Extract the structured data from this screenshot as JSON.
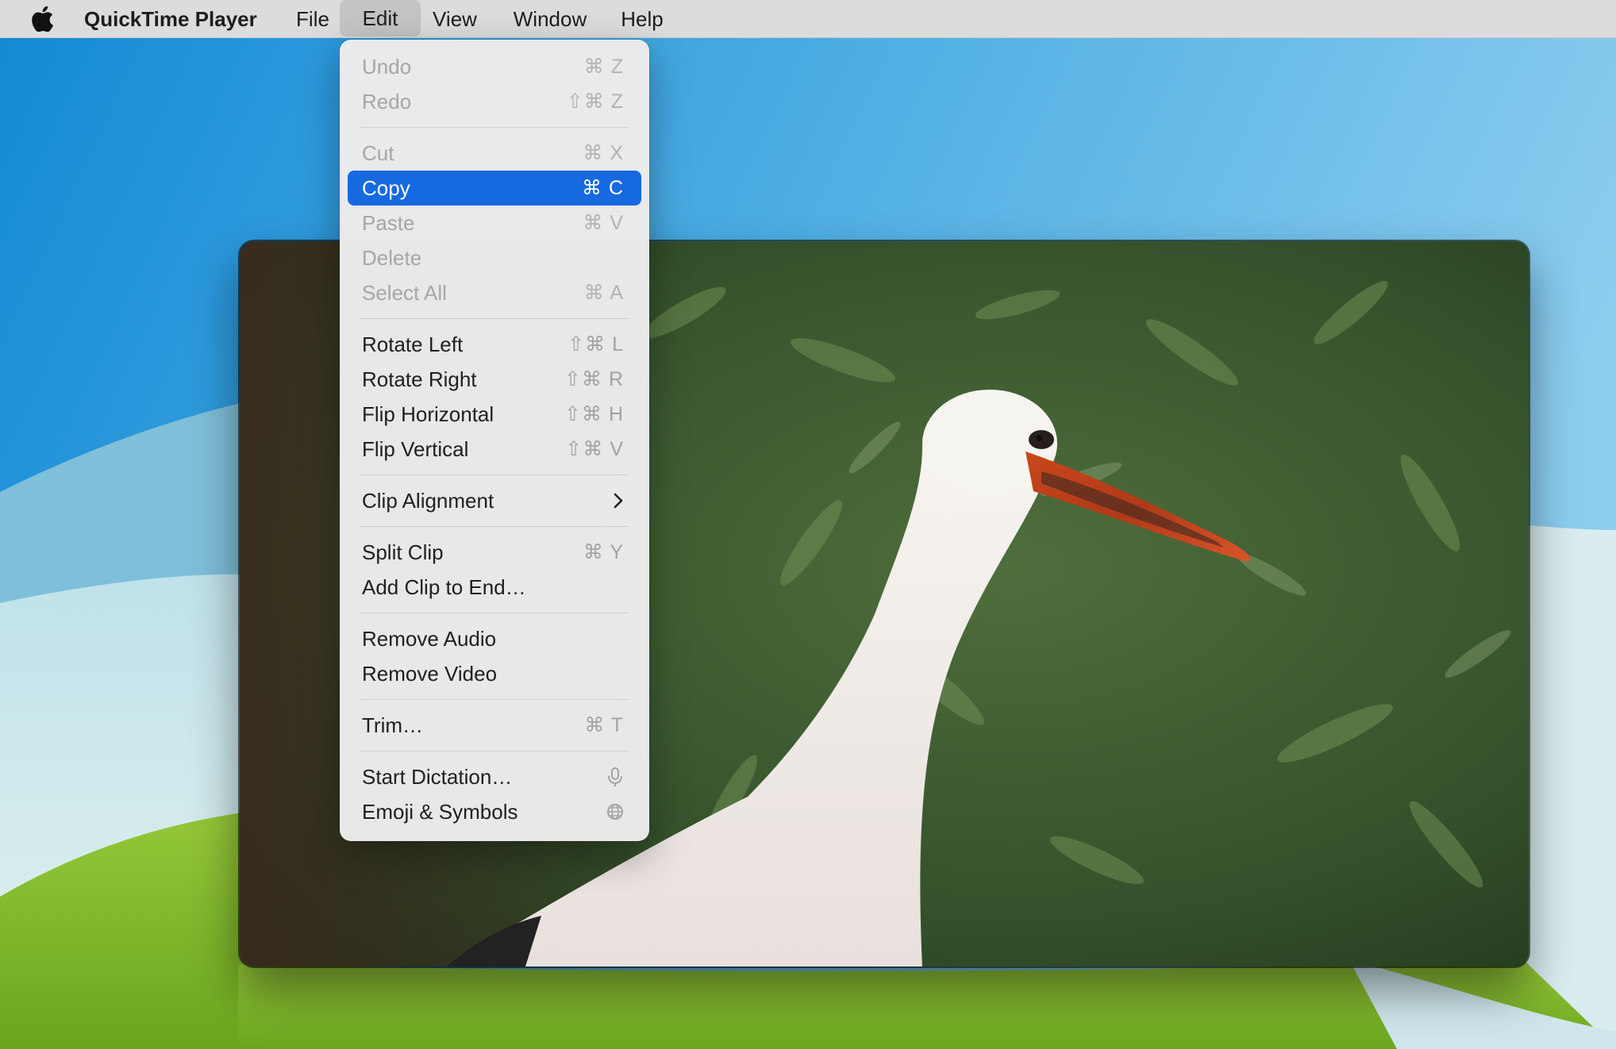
{
  "menubar": {
    "app_name": "QuickTime Player",
    "items": [
      {
        "label": "File"
      },
      {
        "label": "Edit",
        "active": true
      },
      {
        "label": "View"
      },
      {
        "label": "Window"
      },
      {
        "label": "Help"
      }
    ]
  },
  "edit_menu": {
    "groups": [
      [
        {
          "label": "Undo",
          "shortcut": "⌘ Z",
          "enabled": false
        },
        {
          "label": "Redo",
          "shortcut": "⇧⌘ Z",
          "enabled": false
        }
      ],
      [
        {
          "label": "Cut",
          "shortcut": "⌘ X",
          "enabled": false
        },
        {
          "label": "Copy",
          "shortcut": "⌘ C",
          "enabled": true,
          "selected": true
        },
        {
          "label": "Paste",
          "shortcut": "⌘ V",
          "enabled": false
        },
        {
          "label": "Delete",
          "shortcut": "",
          "enabled": false
        },
        {
          "label": "Select All",
          "shortcut": "⌘ A",
          "enabled": false
        }
      ],
      [
        {
          "label": "Rotate Left",
          "shortcut": "⇧⌘ L",
          "enabled": true
        },
        {
          "label": "Rotate Right",
          "shortcut": "⇧⌘ R",
          "enabled": true
        },
        {
          "label": "Flip Horizontal",
          "shortcut": "⇧⌘ H",
          "enabled": true
        },
        {
          "label": "Flip Vertical",
          "shortcut": "⇧⌘ V",
          "enabled": true
        }
      ],
      [
        {
          "label": "Clip Alignment",
          "submenu": true,
          "enabled": true
        }
      ],
      [
        {
          "label": "Split Clip",
          "shortcut": "⌘ Y",
          "enabled": true
        },
        {
          "label": "Add Clip to End…",
          "shortcut": "",
          "enabled": true
        }
      ],
      [
        {
          "label": "Remove Audio",
          "shortcut": "",
          "enabled": true
        },
        {
          "label": "Remove Video",
          "shortcut": "",
          "enabled": true
        }
      ],
      [
        {
          "label": "Trim…",
          "shortcut": "⌘ T",
          "enabled": true
        }
      ],
      [
        {
          "label": "Start Dictation…",
          "icon": "microphone-icon",
          "enabled": true
        },
        {
          "label": "Emoji & Symbols",
          "icon": "globe-icon",
          "enabled": true
        }
      ]
    ]
  },
  "colors": {
    "accent": "#1769e0",
    "menubar": "#dcdcdc",
    "menu_bg": "#ececec"
  }
}
